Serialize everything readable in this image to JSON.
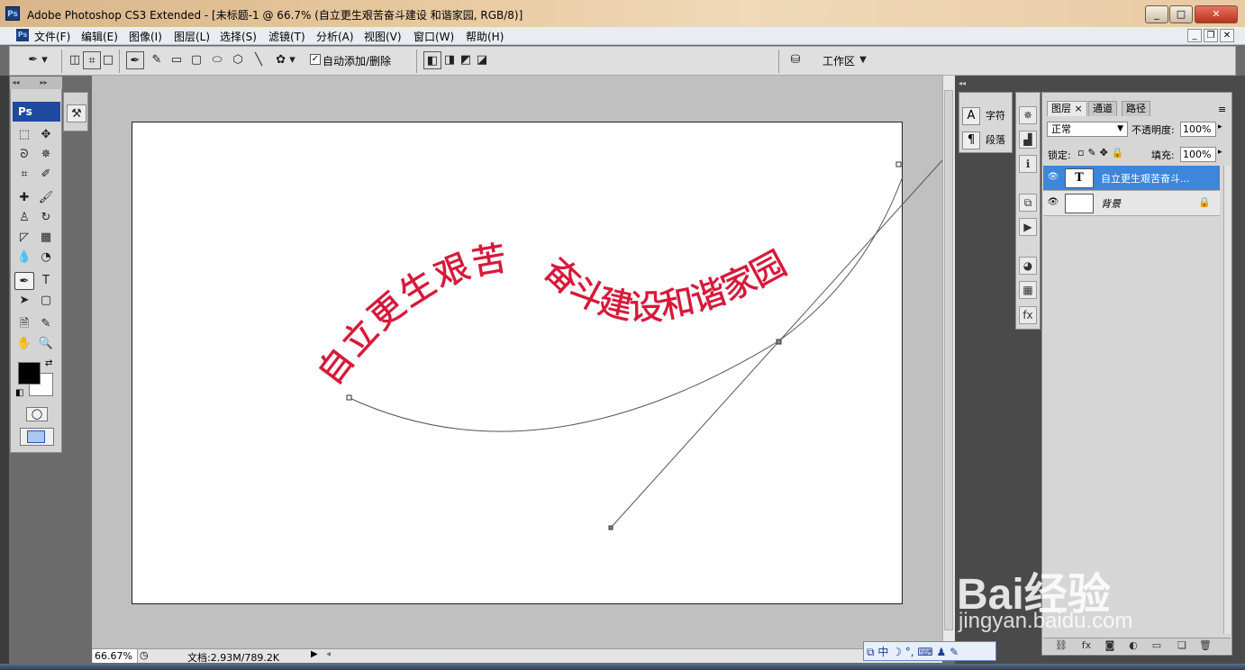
{
  "window": {
    "app_icon": "Ps",
    "title": "Adobe Photoshop CS3 Extended - [未标题-1 @ 66.7% (自立更生艰苦奋斗建设 和谐家园, RGB/8)]",
    "controls": [
      "_",
      "□",
      "✕"
    ]
  },
  "menubar": {
    "items": [
      "文件(F)",
      "编辑(E)",
      "图像(I)",
      "图层(L)",
      "选择(S)",
      "滤镜(T)",
      "分析(A)",
      "视图(V)",
      "窗口(W)",
      "帮助(H)"
    ]
  },
  "options": {
    "auto_add_label": "自动添加/删除",
    "auto_add_checked": "✓",
    "workspace_label": "工作区"
  },
  "toolbox": {
    "logo": "Ps",
    "icons": [
      "marquee-icon",
      "move-icon",
      "lasso-icon",
      "magic-wand-icon",
      "crop-icon",
      "slice-icon",
      "healing-icon",
      "brush-icon",
      "stamp-icon",
      "history-brush-icon",
      "eraser-icon",
      "gradient-icon",
      "blur-icon",
      "dodge-icon",
      "pen-icon",
      "type-icon",
      "path-select-icon",
      "shape-icon",
      "notes-icon",
      "eyedropper-icon",
      "hand-icon",
      "zoom-icon"
    ]
  },
  "canvas": {
    "text_line1": "自立更生艰苦",
    "text_line2": "奋斗建设和谐家园",
    "text_color": "#d8193a",
    "path_color": "#444444"
  },
  "status": {
    "zoom": "66.67%",
    "doc_info": "文档:2.93M/789.2K"
  },
  "char_panel": {
    "character_label": "字符",
    "paragraph_label": "段落"
  },
  "layers_panel": {
    "tabs": [
      "图层",
      "通道",
      "路径"
    ],
    "blend_mode": "正常",
    "opacity_label": "不透明度:",
    "opacity_value": "100%",
    "lock_label": "锁定:",
    "fill_label": "填充:",
    "fill_value": "100%",
    "layers": [
      {
        "name": "自立更生艰苦奋斗...",
        "thumb": "T",
        "selected": true
      },
      {
        "name": "背景",
        "thumb": "",
        "selected": false
      }
    ]
  },
  "watermark": {
    "brand": "Bai经验",
    "url": "jingyan.baidu.com"
  },
  "ime": {
    "label": "中"
  }
}
